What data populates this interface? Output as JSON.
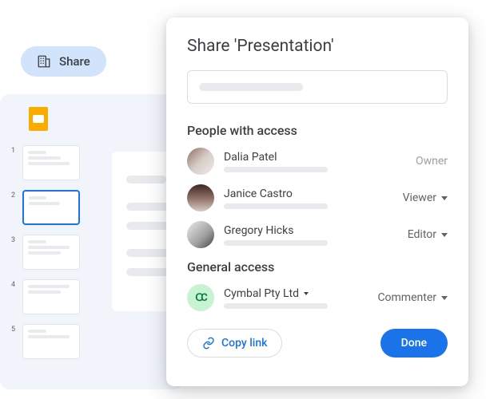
{
  "shareChip": {
    "label": "Share"
  },
  "dialog": {
    "title": "Share 'Presentation'",
    "peopleHeading": "People with access",
    "generalHeading": "General access",
    "people": [
      {
        "name": "Dalia Patel",
        "role": "Owner"
      },
      {
        "name": "Janice Castro",
        "role": "Viewer"
      },
      {
        "name": "Gregory Hicks",
        "role": "Editor"
      }
    ],
    "general": {
      "name": "Cymbal Pty Ltd",
      "role": "Commenter"
    },
    "copyLink": "Copy link",
    "done": "Done"
  },
  "thumbs": [
    "1",
    "2",
    "3",
    "4",
    "5"
  ]
}
